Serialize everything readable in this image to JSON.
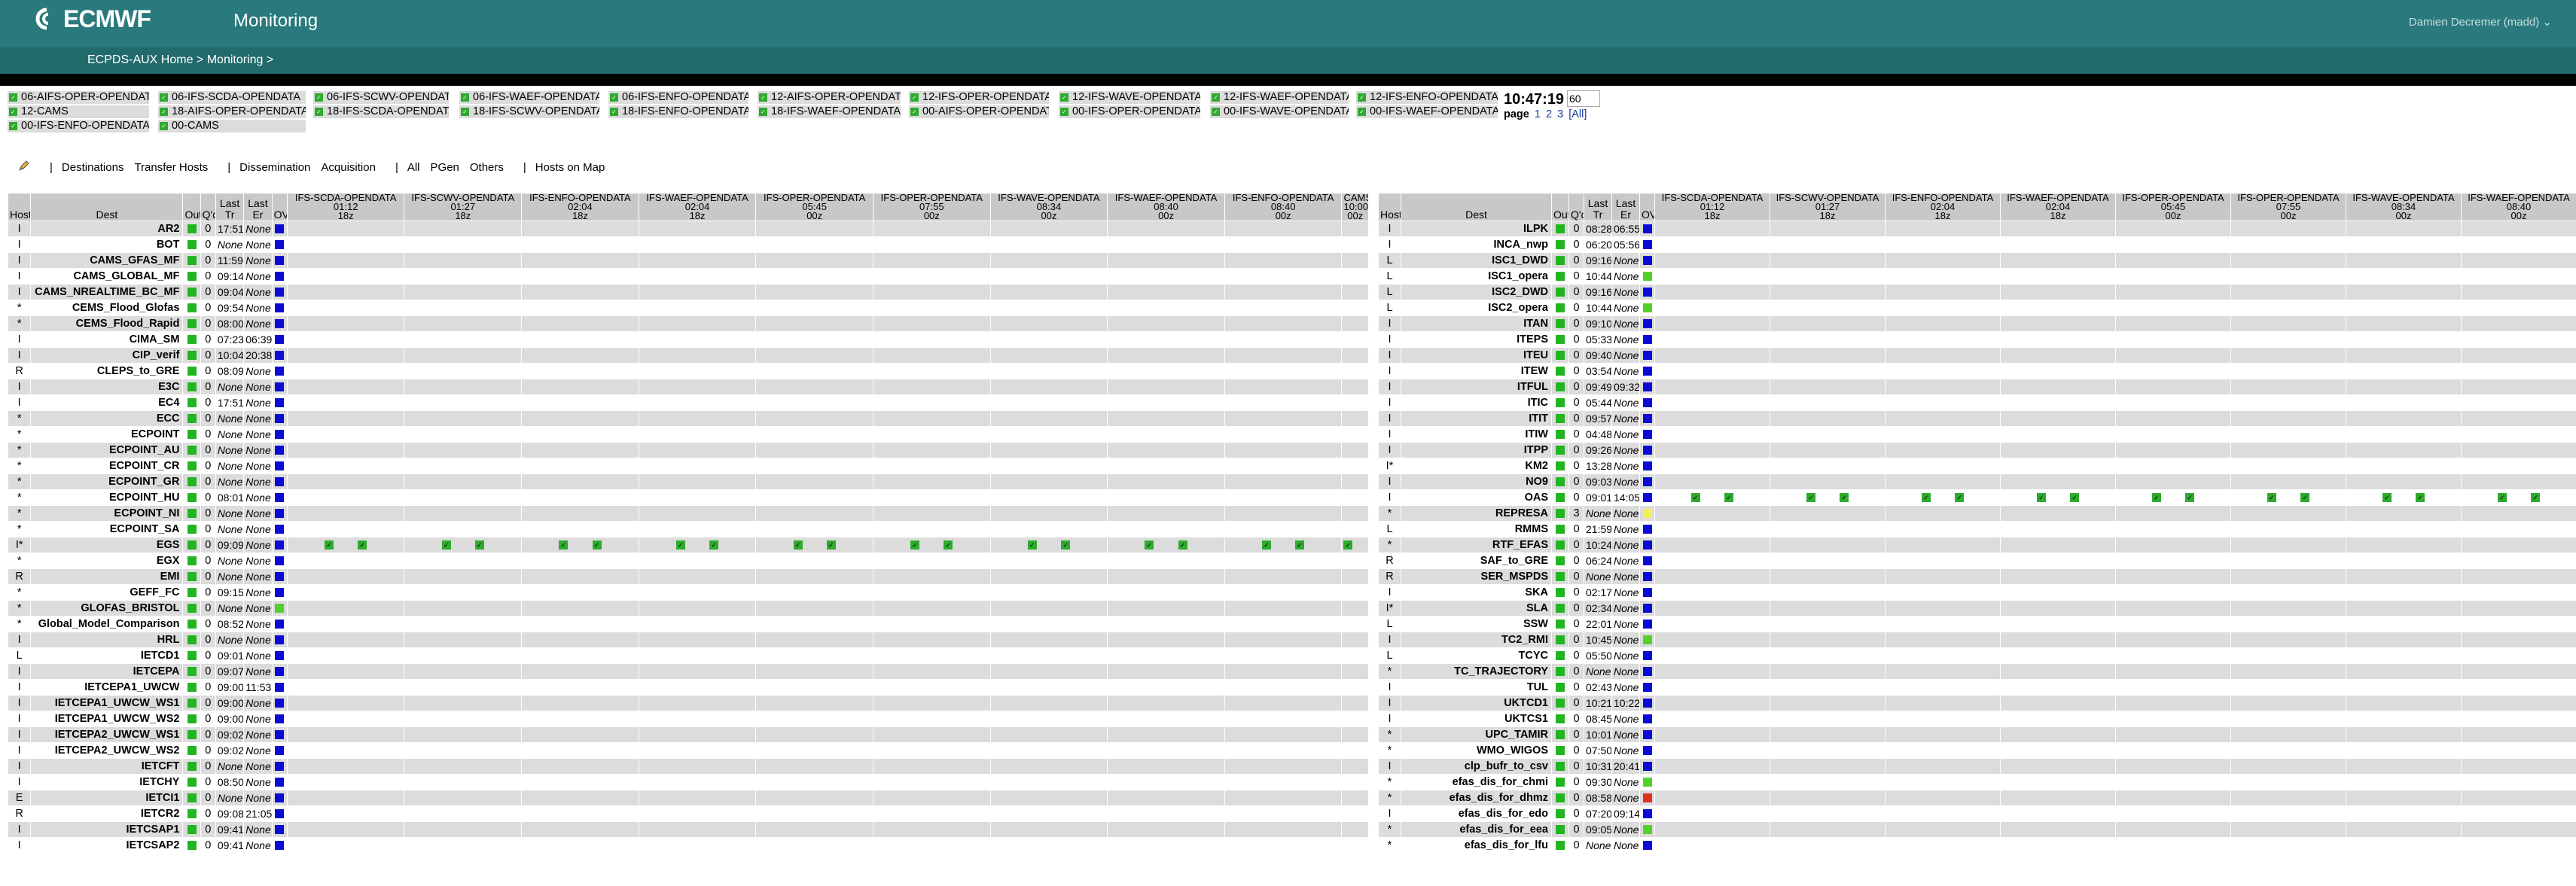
{
  "header": {
    "logo_text": "ECMWF",
    "title": "Monitoring",
    "user": "Damien Decremer (madd) ⌄"
  },
  "breadcrumb": {
    "home": "ECPDS-AUX Home",
    "sep": " > ",
    "current": "Monitoring",
    "trail": " >"
  },
  "streams": [
    [
      "06-AIFS-OPER-OPENDATA",
      "06-IFS-SCDA-OPENDATA",
      "06-IFS-SCWV-OPENDATA",
      "06-IFS-WAEF-OPENDATA",
      "06-IFS-ENFO-OPENDATA",
      "12-AIFS-OPER-OPENDATA",
      "12-IFS-OPER-OPENDATA",
      "12-IFS-WAVE-OPENDATA",
      "12-IFS-WAEF-OPENDATA",
      "12-IFS-ENFO-OPENDATA"
    ],
    [
      "12-CAMS",
      "18-AIFS-OPER-OPENDATA",
      "18-IFS-SCDA-OPENDATA",
      "18-IFS-SCWV-OPENDATA",
      "18-IFS-ENFO-OPENDATA",
      "18-IFS-WAEF-OPENDATA",
      "00-AIFS-OPER-OPENDATA",
      "00-IFS-OPER-OPENDATA",
      "00-IFS-WAVE-OPENDATA",
      "00-IFS-WAEF-OPENDATA"
    ],
    [
      "00-IFS-ENFO-OPENDATA",
      "00-CAMS"
    ]
  ],
  "clock": "10:47:19",
  "refresh": "60",
  "pager": {
    "label": "page",
    "pages": [
      "1",
      "2",
      "3"
    ],
    "all": "[All]"
  },
  "filters": {
    "edit_icon": "pencil-icon",
    "items": [
      "Destinations",
      "Transfer Hosts",
      "Dissemination",
      "Acquisition",
      "All",
      "PGen",
      "Others",
      "Hosts on Map"
    ]
  },
  "table_headers": {
    "host": "Host",
    "dest": "Dest",
    "outs": "Outs",
    "qd": "Q'd",
    "last_tr_1": "Last",
    "last_tr_2": "Tr",
    "last_er_1": "Last",
    "last_er_2": "Er",
    "ov": "OV"
  },
  "left_streams": [
    {
      "name": "IFS-SCDA-OPENDATA",
      "time": "01:12",
      "run": "18z"
    },
    {
      "name": "IFS-SCWV-OPENDATA",
      "time": "01:27",
      "run": "18z"
    },
    {
      "name": "IFS-ENFO-OPENDATA",
      "time": "02:04",
      "run": "18z"
    },
    {
      "name": "IFS-WAEF-OPENDATA",
      "time": "02:04",
      "run": "18z"
    },
    {
      "name": "IFS-OPER-OPENDATA",
      "time": "05:45",
      "run": "00z"
    },
    {
      "name": "IFS-OPER-OPENDATA",
      "time": "07:55",
      "run": "00z"
    },
    {
      "name": "IFS-WAVE-OPENDATA",
      "time": "08:34",
      "run": "00z"
    },
    {
      "name": "IFS-WAEF-OPENDATA",
      "time": "08:40",
      "run": "00z"
    },
    {
      "name": "IFS-ENFO-OPENDATA",
      "time": "08:40",
      "run": "00z"
    },
    {
      "name": "CAMS",
      "time": "10:00",
      "run": "00z"
    }
  ],
  "right_streams": [
    {
      "name": "IFS-SCDA-OPENDATA",
      "time": "01:12",
      "run": "18z"
    },
    {
      "name": "IFS-SCWV-OPENDATA",
      "time": "01:27",
      "run": "18z"
    },
    {
      "name": "IFS-ENFO-OPENDATA",
      "time": "02:04",
      "run": "18z"
    },
    {
      "name": "IFS-WAEF-OPENDATA",
      "time": "02:04",
      "run": "18z"
    },
    {
      "name": "IFS-OPER-OPENDATA",
      "time": "05:45",
      "run": "00z"
    },
    {
      "name": "IFS-OPER-OPENDATA",
      "time": "07:55",
      "run": "00z"
    },
    {
      "name": "IFS-WAVE-OPENDATA",
      "time": "08:34",
      "run": "00z"
    },
    {
      "name": "IFS-WAEF-OPENDATA",
      "time": "08:40",
      "run": "00z"
    }
  ],
  "left_rows": [
    [
      "I",
      "AR2",
      "g",
      "0",
      "17:51",
      "None",
      "b"
    ],
    [
      "I",
      "BOT",
      "g",
      "0",
      "None",
      "None",
      "b"
    ],
    [
      "I",
      "CAMS_GFAS_MF",
      "g",
      "0",
      "11:59",
      "None",
      "b"
    ],
    [
      "I",
      "CAMS_GLOBAL_MF",
      "g",
      "0",
      "09:14",
      "None",
      "b"
    ],
    [
      "I",
      "CAMS_NREALTIME_BC_MF",
      "g",
      "0",
      "09:04",
      "None",
      "b"
    ],
    [
      "*",
      "CEMS_Flood_Glofas",
      "g",
      "0",
      "09:54",
      "None",
      "b"
    ],
    [
      "*",
      "CEMS_Flood_Rapid",
      "g",
      "0",
      "08:00",
      "None",
      "b"
    ],
    [
      "I",
      "CIMA_SM",
      "g",
      "0",
      "07:23",
      "06:39",
      "b"
    ],
    [
      "I",
      "CIP_verif",
      "g",
      "0",
      "10:04",
      "20:38",
      "b"
    ],
    [
      "R",
      "CLEPS_to_GRE",
      "g",
      "0",
      "08:09",
      "None",
      "b"
    ],
    [
      "I",
      "E3C",
      "g",
      "0",
      "None",
      "None",
      "b"
    ],
    [
      "I",
      "EC4",
      "g",
      "0",
      "17:51",
      "None",
      "b"
    ],
    [
      "*",
      "ECC",
      "g",
      "0",
      "None",
      "None",
      "b"
    ],
    [
      "*",
      "ECPOINT",
      "g",
      "0",
      "None",
      "None",
      "b"
    ],
    [
      "*",
      "ECPOINT_AU",
      "g",
      "0",
      "None",
      "None",
      "b"
    ],
    [
      "*",
      "ECPOINT_CR",
      "g",
      "0",
      "None",
      "None",
      "b"
    ],
    [
      "*",
      "ECPOINT_GR",
      "g",
      "0",
      "None",
      "None",
      "b"
    ],
    [
      "*",
      "ECPOINT_HU",
      "g",
      "0",
      "08:01",
      "None",
      "b"
    ],
    [
      "*",
      "ECPOINT_NI",
      "g",
      "0",
      "None",
      "None",
      "b"
    ],
    [
      "*",
      "ECPOINT_SA",
      "g",
      "0",
      "None",
      "None",
      "b"
    ],
    [
      "I*",
      "EGS",
      "g",
      "0",
      "09:09",
      "None",
      "b"
    ],
    [
      "*",
      "EGX",
      "g",
      "0",
      "None",
      "None",
      "b"
    ],
    [
      "R",
      "EMI",
      "g",
      "0",
      "None",
      "None",
      "b"
    ],
    [
      "*",
      "GEFF_FC",
      "g",
      "0",
      "09:15",
      "None",
      "b"
    ],
    [
      "*",
      "GLOFAS_BRISTOL",
      "g",
      "0",
      "None",
      "None",
      "lg"
    ],
    [
      "*",
      "Global_Model_Comparison",
      "g",
      "0",
      "08:52",
      "None",
      "b"
    ],
    [
      "I",
      "HRL",
      "g",
      "0",
      "None",
      "None",
      "b"
    ],
    [
      "L",
      "IETCD1",
      "g",
      "0",
      "09:01",
      "None",
      "b"
    ],
    [
      "I",
      "IETCEPA",
      "g",
      "0",
      "09:07",
      "None",
      "b"
    ],
    [
      "I",
      "IETCEPA1_UWCW",
      "g",
      "0",
      "09:00",
      "11:53",
      "b"
    ],
    [
      "I",
      "IETCEPA1_UWCW_WS1",
      "g",
      "0",
      "09:00",
      "None",
      "b"
    ],
    [
      "I",
      "IETCEPA1_UWCW_WS2",
      "g",
      "0",
      "09:00",
      "None",
      "b"
    ],
    [
      "I",
      "IETCEPA2_UWCW_WS1",
      "g",
      "0",
      "09:02",
      "None",
      "b"
    ],
    [
      "I",
      "IETCEPA2_UWCW_WS2",
      "g",
      "0",
      "09:02",
      "None",
      "b"
    ],
    [
      "I",
      "IETCFT",
      "g",
      "0",
      "None",
      "None",
      "b"
    ],
    [
      "I",
      "IETCHY",
      "g",
      "0",
      "08:50",
      "None",
      "b"
    ],
    [
      "E",
      "IETCI1",
      "g",
      "0",
      "None",
      "None",
      "b"
    ],
    [
      "R",
      "IETCR2",
      "g",
      "0",
      "09:08",
      "21:05",
      "b"
    ],
    [
      "I",
      "IETCSAP1",
      "g",
      "0",
      "09:41",
      "None",
      "b"
    ],
    [
      "I",
      "IETCSAP2",
      "g",
      "0",
      "09:41",
      "None",
      "b"
    ]
  ],
  "right_rows": [
    [
      "I",
      "ILPK",
      "g",
      "0",
      "08:28",
      "06:55",
      "b"
    ],
    [
      "I",
      "INCA_nwp",
      "g",
      "0",
      "06:20",
      "05:56",
      "b"
    ],
    [
      "L",
      "ISC1_DWD",
      "g",
      "0",
      "09:16",
      "None",
      "b"
    ],
    [
      "L",
      "ISC1_opera",
      "g",
      "0",
      "10:44",
      "None",
      "lg"
    ],
    [
      "L",
      "ISC2_DWD",
      "g",
      "0",
      "09:16",
      "None",
      "b"
    ],
    [
      "L",
      "ISC2_opera",
      "g",
      "0",
      "10:44",
      "None",
      "lg"
    ],
    [
      "I",
      "ITAN",
      "g",
      "0",
      "09:10",
      "None",
      "b"
    ],
    [
      "I",
      "ITEPS",
      "g",
      "0",
      "05:33",
      "None",
      "b"
    ],
    [
      "I",
      "ITEU",
      "g",
      "0",
      "09:40",
      "None",
      "b"
    ],
    [
      "I",
      "ITEW",
      "g",
      "0",
      "03:54",
      "None",
      "b"
    ],
    [
      "I",
      "ITFUL",
      "g",
      "0",
      "09:49",
      "09:32",
      "b"
    ],
    [
      "I",
      "ITIC",
      "g",
      "0",
      "05:44",
      "None",
      "b"
    ],
    [
      "I",
      "ITIT",
      "g",
      "0",
      "09:57",
      "None",
      "b"
    ],
    [
      "I",
      "ITIW",
      "g",
      "0",
      "04:48",
      "None",
      "b"
    ],
    [
      "I",
      "ITPP",
      "g",
      "0",
      "09:26",
      "None",
      "b"
    ],
    [
      "I*",
      "KM2",
      "g",
      "0",
      "13:28",
      "None",
      "b"
    ],
    [
      "I",
      "NO9",
      "g",
      "0",
      "09:03",
      "None",
      "b"
    ],
    [
      "I",
      "OAS",
      "g",
      "0",
      "09:01",
      "14:05",
      "b"
    ],
    [
      "*",
      "REPRESA",
      "g",
      "3",
      "None",
      "None",
      "y"
    ],
    [
      "L",
      "RMMS",
      "g",
      "0",
      "21:59",
      "None",
      "b"
    ],
    [
      "*",
      "RTF_EFAS",
      "g",
      "0",
      "10:24",
      "None",
      "b"
    ],
    [
      "R",
      "SAF_to_GRE",
      "g",
      "0",
      "06:24",
      "None",
      "b"
    ],
    [
      "R",
      "SER_MSPDS",
      "g",
      "0",
      "None",
      "None",
      "b"
    ],
    [
      "I",
      "SKA",
      "g",
      "0",
      "02:17",
      "None",
      "b"
    ],
    [
      "I*",
      "SLA",
      "g",
      "0",
      "02:34",
      "None",
      "b"
    ],
    [
      "L",
      "SSW",
      "g",
      "0",
      "22:01",
      "None",
      "b"
    ],
    [
      "I",
      "TC2_RMI",
      "g",
      "0",
      "10:45",
      "None",
      "lg"
    ],
    [
      "L",
      "TCYC",
      "g",
      "0",
      "05:50",
      "None",
      "b"
    ],
    [
      "*",
      "TC_TRAJECTORY",
      "g",
      "0",
      "None",
      "None",
      "b"
    ],
    [
      "I",
      "TUL",
      "g",
      "0",
      "02:43",
      "None",
      "b"
    ],
    [
      "I",
      "UKTCD1",
      "g",
      "0",
      "10:21",
      "10:22",
      "b"
    ],
    [
      "I",
      "UKTCS1",
      "g",
      "0",
      "08:45",
      "None",
      "b"
    ],
    [
      "*",
      "UPC_TAMIR",
      "g",
      "0",
      "10:01",
      "None",
      "b"
    ],
    [
      "*",
      "WMO_WIGOS",
      "g",
      "0",
      "07:50",
      "None",
      "b"
    ],
    [
      "I",
      "clp_bufr_to_csv",
      "g",
      "0",
      "10:31",
      "20:41",
      "b"
    ],
    [
      "*",
      "efas_dis_for_chmi",
      "g",
      "0",
      "09:30",
      "None",
      "lg"
    ],
    [
      "*",
      "efas_dis_for_dhmz",
      "g",
      "0",
      "08:58",
      "None",
      "r"
    ],
    [
      "I",
      "efas_dis_for_edo",
      "g",
      "0",
      "07:20",
      "09:14",
      "b"
    ],
    [
      "*",
      "efas_dis_for_eea",
      "g",
      "0",
      "09:05",
      "None",
      "lg"
    ],
    [
      "*",
      "efas_dis_for_lfu",
      "g",
      "0",
      "None",
      "None",
      "b"
    ]
  ],
  "left_tick_row": "EGS",
  "right_tick_row": "OAS",
  "colors": {
    "topbar": "#2a7a7d",
    "ok": "#22b522",
    "overview": "#0b0bd3",
    "warn": "#f2f05a",
    "error": "#e0301e"
  }
}
